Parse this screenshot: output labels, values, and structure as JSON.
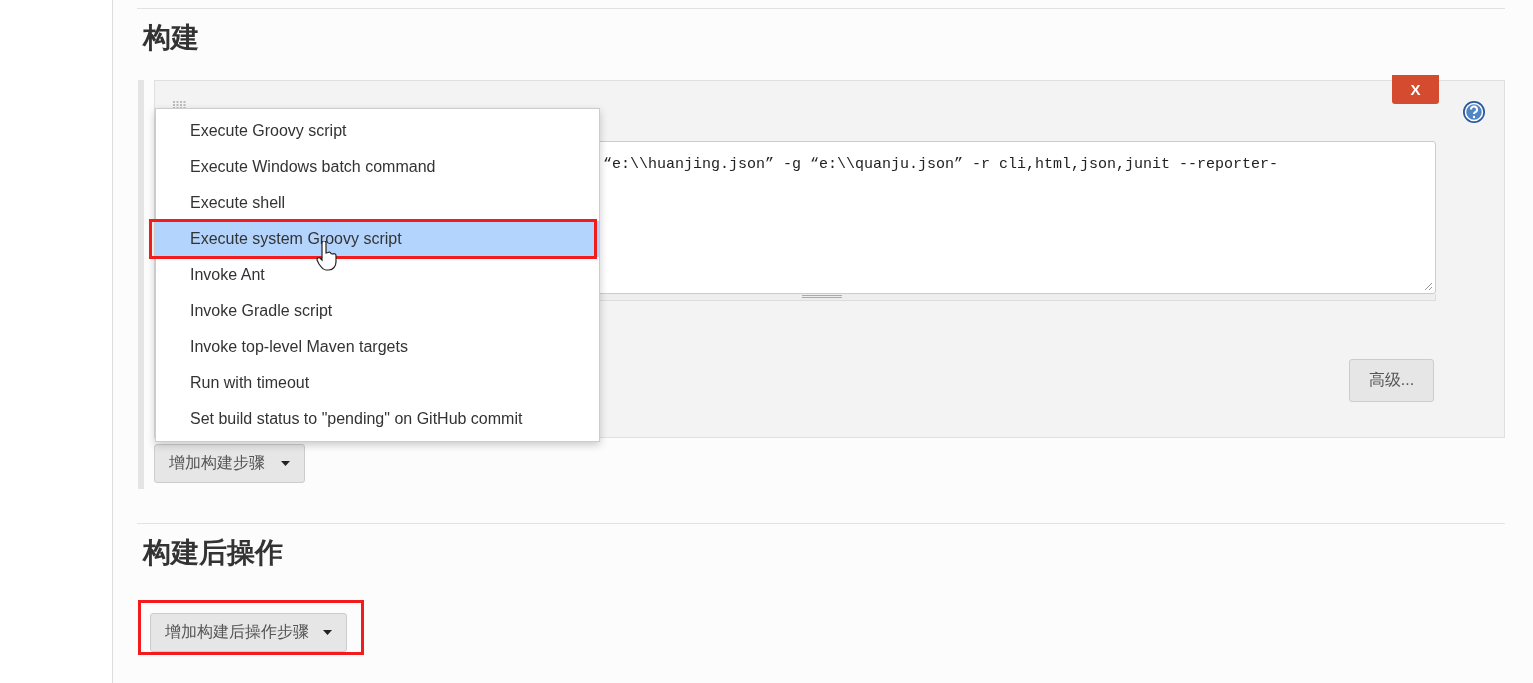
{
  "build_section": {
    "title": "构建",
    "step": {
      "command_value": "“e:\\\\huanjing.json” -g “e:\\\\quanju.json” -r cli,html,json,junit --reporter-",
      "delete_label": "X",
      "advanced_label": "高级..."
    },
    "add_step_button": {
      "label": "增加构建步骤",
      "expanded": true
    },
    "step_menu": [
      {
        "label": "Execute Groovy script",
        "selected": false,
        "annotated": false
      },
      {
        "label": "Execute Windows batch command",
        "selected": false,
        "annotated": false
      },
      {
        "label": "Execute shell",
        "selected": false,
        "annotated": false
      },
      {
        "label": "Execute system Groovy script",
        "selected": true,
        "annotated": true
      },
      {
        "label": "Invoke Ant",
        "selected": false,
        "annotated": false
      },
      {
        "label": "Invoke Gradle script",
        "selected": false,
        "annotated": false
      },
      {
        "label": "Invoke top-level Maven targets",
        "selected": false,
        "annotated": false
      },
      {
        "label": "Run with timeout",
        "selected": false,
        "annotated": false
      },
      {
        "label": "Set build status to \"pending\" on GitHub commit",
        "selected": false,
        "annotated": false
      }
    ]
  },
  "post_build_section": {
    "title": "构建后操作",
    "add_button": {
      "label": "增加构建后操作步骤",
      "annotated": true
    }
  }
}
